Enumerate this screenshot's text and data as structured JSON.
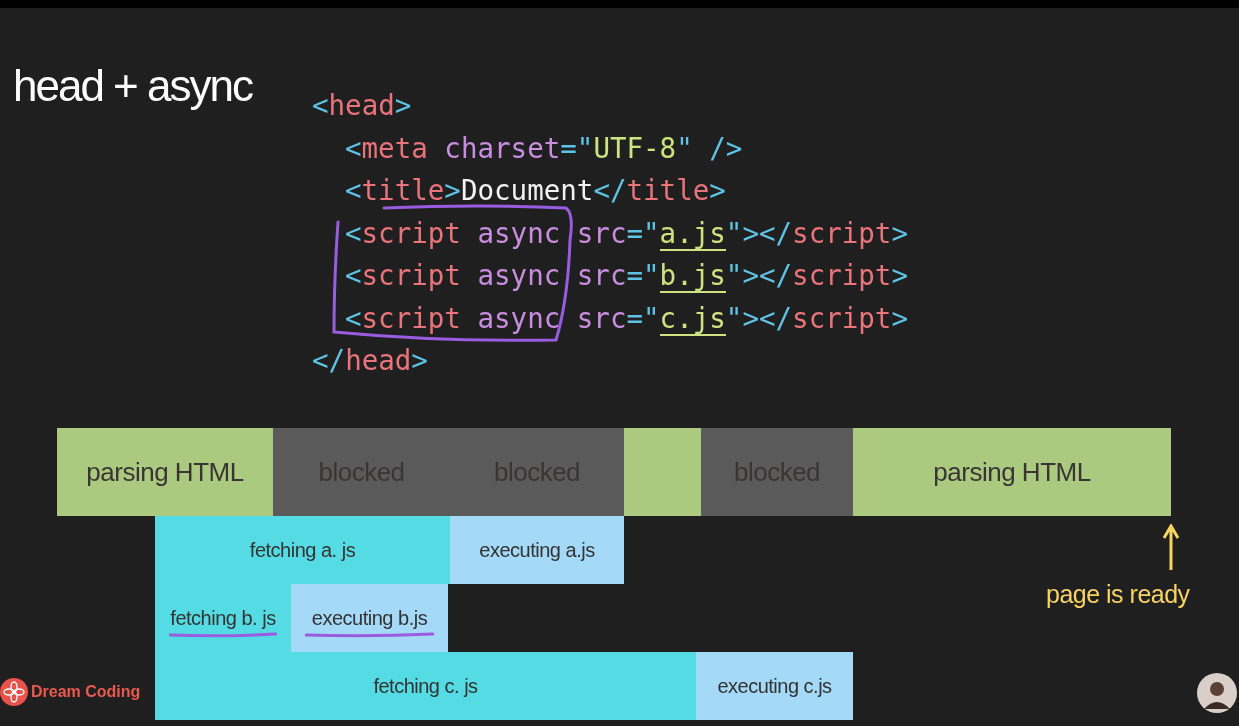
{
  "slide": {
    "title": "head + async"
  },
  "code": {
    "lines": [
      {
        "kind": "outer",
        "tokens": [
          {
            "text": "<",
            "kind": "punct"
          },
          {
            "text": "head",
            "kind": "tag"
          },
          {
            "text": ">",
            "kind": "punct"
          }
        ]
      },
      {
        "kind": "inner",
        "tokens": [
          {
            "text": "<",
            "kind": "punct"
          },
          {
            "text": "meta",
            "kind": "tag"
          },
          {
            "text": " charset",
            "kind": "attr"
          },
          {
            "text": "=\"",
            "kind": "punct"
          },
          {
            "text": "UTF-8",
            "kind": "string"
          },
          {
            "text": "\"",
            "kind": "punct"
          },
          {
            "text": " />",
            "kind": "punct"
          }
        ]
      },
      {
        "kind": "inner",
        "tokens": [
          {
            "text": "<",
            "kind": "punct"
          },
          {
            "text": "title",
            "kind": "tag"
          },
          {
            "text": ">",
            "kind": "punct"
          },
          {
            "text": "Document",
            "kind": "text"
          },
          {
            "text": "</",
            "kind": "punct"
          },
          {
            "text": "title",
            "kind": "tag"
          },
          {
            "text": ">",
            "kind": "punct"
          }
        ]
      },
      {
        "kind": "inner",
        "tokens": [
          {
            "text": "<",
            "kind": "punct"
          },
          {
            "text": "script",
            "kind": "tag"
          },
          {
            "text": " async",
            "kind": "attr"
          },
          {
            "text": " src",
            "kind": "attr"
          },
          {
            "text": "=\"",
            "kind": "punct"
          },
          {
            "text": "a.js",
            "kind": "string",
            "underlined": true
          },
          {
            "text": "\"",
            "kind": "punct"
          },
          {
            "text": "></",
            "kind": "punct"
          },
          {
            "text": "script",
            "kind": "tag"
          },
          {
            "text": ">",
            "kind": "punct"
          }
        ]
      },
      {
        "kind": "inner",
        "tokens": [
          {
            "text": "<",
            "kind": "punct"
          },
          {
            "text": "script",
            "kind": "tag"
          },
          {
            "text": " async",
            "kind": "attr"
          },
          {
            "text": " src",
            "kind": "attr"
          },
          {
            "text": "=\"",
            "kind": "punct"
          },
          {
            "text": "b.js",
            "kind": "string",
            "underlined": true
          },
          {
            "text": "\"",
            "kind": "punct"
          },
          {
            "text": "></",
            "kind": "punct"
          },
          {
            "text": "script",
            "kind": "tag"
          },
          {
            "text": ">",
            "kind": "punct"
          }
        ]
      },
      {
        "kind": "inner",
        "tokens": [
          {
            "text": "<",
            "kind": "punct"
          },
          {
            "text": "script",
            "kind": "tag"
          },
          {
            "text": " async",
            "kind": "attr"
          },
          {
            "text": " src",
            "kind": "attr"
          },
          {
            "text": "=\"",
            "kind": "punct"
          },
          {
            "text": "c.js",
            "kind": "string",
            "underlined": true
          },
          {
            "text": "\"",
            "kind": "punct"
          },
          {
            "text": "></",
            "kind": "punct"
          },
          {
            "text": "script",
            "kind": "tag"
          },
          {
            "text": ">",
            "kind": "punct"
          }
        ]
      },
      {
        "kind": "outer",
        "tokens": [
          {
            "text": "</",
            "kind": "punct"
          },
          {
            "text": "head",
            "kind": "tag"
          },
          {
            "text": ">",
            "kind": "punct"
          }
        ]
      }
    ]
  },
  "timeline": {
    "main": [
      {
        "label": "parsing HTML",
        "kind": "parse"
      },
      {
        "label": "blocked",
        "kind": "blocked"
      },
      {
        "label": "blocked",
        "kind": "blocked"
      },
      {
        "kind": "parse"
      },
      {
        "label": "blocked",
        "kind": "blocked"
      },
      {
        "label": "parsing HTML",
        "kind": "parse"
      }
    ],
    "scripts": [
      {
        "segments": [
          {
            "label": "fetching a. js",
            "kind": "fetch",
            "underlined": false
          },
          {
            "label": "executing a.js",
            "kind": "execute",
            "underlined": false
          }
        ]
      },
      {
        "segments": [
          {
            "label": "fetching b. js",
            "kind": "fetch",
            "underlined": true
          },
          {
            "label": "executing b.js",
            "kind": "execute",
            "underlined": true
          }
        ]
      },
      {
        "segments": [
          {
            "label": "fetching c. js",
            "kind": "fetch",
            "underlined": false
          },
          {
            "label": "executing c.js",
            "kind": "execute",
            "underlined": false
          }
        ]
      }
    ],
    "marker": {
      "label": "page is ready"
    }
  },
  "channel": {
    "name": "Dream Coding"
  }
}
